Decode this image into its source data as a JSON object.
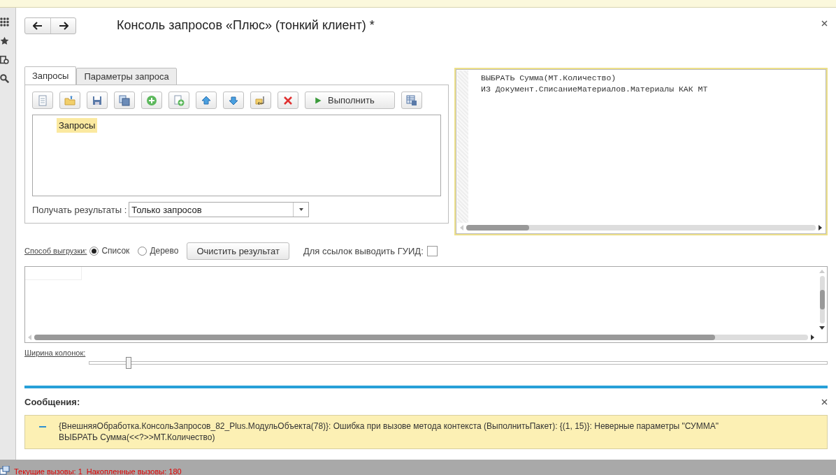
{
  "window": {
    "title": "Консоль запросов «Плюс» (тонкий клиент) *"
  },
  "tabs": [
    {
      "label": "Запросы",
      "selected": true
    },
    {
      "label": "Параметры запроса",
      "selected": false
    }
  ],
  "toolbar": [
    {
      "kind": "document"
    },
    {
      "kind": "folder"
    },
    {
      "kind": "save"
    },
    {
      "kind": "copy"
    },
    {
      "kind": "add"
    },
    {
      "kind": "add-document"
    },
    {
      "kind": "up"
    },
    {
      "kind": "down"
    },
    {
      "kind": "restore"
    },
    {
      "kind": "delete"
    },
    {
      "kind": "run",
      "label": "Выполнить"
    },
    {
      "kind": "table"
    }
  ],
  "query_tree": {
    "items": [
      {
        "label": "Запросы",
        "selected": true
      }
    ]
  },
  "results_mode": {
    "label": "Получать результаты :",
    "value": "Только запросов"
  },
  "query_text": [
    "ВЫБРАТЬ Сумма(МТ.Количество)",
    "ИЗ Документ.СписаниеМатериалов.Материалы КАК МТ"
  ],
  "export": {
    "label": "Способ выгрузки:",
    "options": [
      {
        "label": "Список",
        "selected": true
      },
      {
        "label": "Дерево",
        "selected": false
      }
    ]
  },
  "clear_button": "Очистить результат",
  "guid": {
    "label": "Для ссылок выводить ГУИД:",
    "checked": false
  },
  "column_width": {
    "label": "Ширина колонок:",
    "level": 0.053
  },
  "messages": {
    "title": "Сообщения:",
    "items": [
      {
        "lines": [
          "{ВнешняяОбработка.КонсольЗапросов_82_Plus.МодульОбъекта(78)}: Ошибка при вызове метода контекста (ВыполнитьПакет): {(1, 15)}: Неверные параметры \"СУММА\"",
          "ВЫБРАТЬ Сумма(<<?>>МТ.Количество)"
        ]
      }
    ]
  },
  "status_bar": {
    "current": "Текущие вызовы: 1",
    "accumulated": "Накопленные вызовы: 180"
  }
}
